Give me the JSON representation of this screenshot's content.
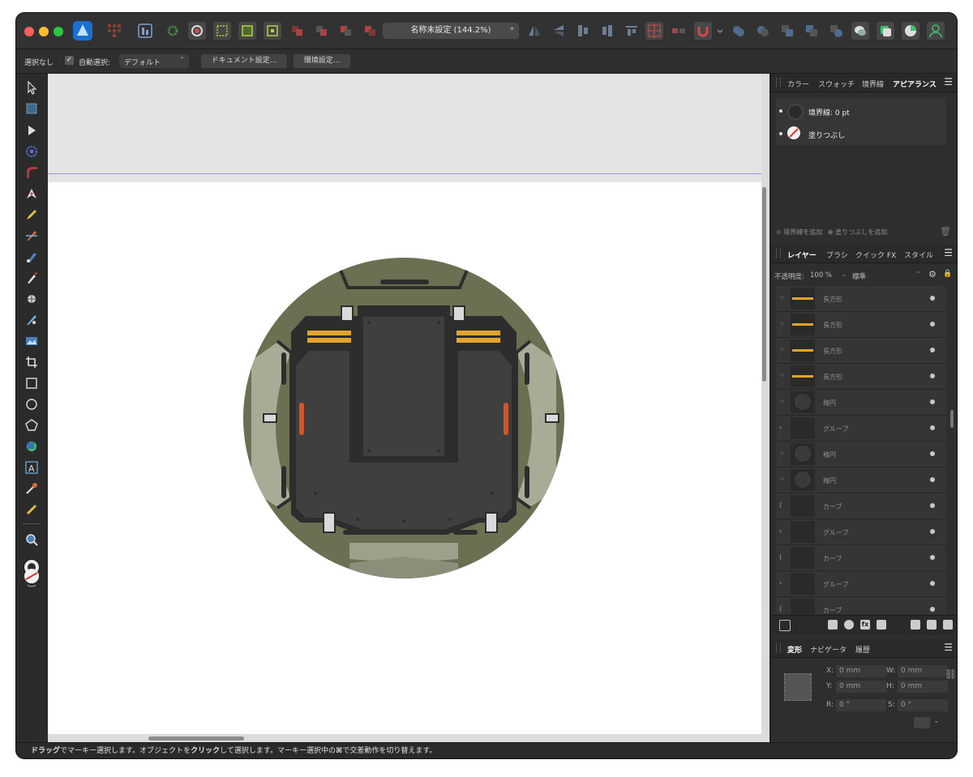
{
  "document_title": "名称未設定 (144.2%)",
  "modified_mark": "*",
  "context_toolbar": {
    "selection": "選択なし",
    "auto_select_label": "自動選択:",
    "auto_select_value": "デフォルト",
    "document_setup": "ドキュメント設定...",
    "preferences": "環境設定..."
  },
  "appearance_panel": {
    "tabs": [
      "カラー",
      "スウォッチ",
      "境界線",
      "アピアランス"
    ],
    "active_tab": "アピアランス",
    "stroke_label": "境界線: 0 pt",
    "fill_label": "塗りつぶし",
    "add_stroke": "境界線を追加",
    "add_fill": "塗りつぶしを追加"
  },
  "layers_panel": {
    "tabs": [
      "レイヤー",
      "ブラシ",
      "クイック FX",
      "スタイル"
    ],
    "active_tab": "レイヤー",
    "opacity_label": "不透明度:",
    "opacity_value": "100 %",
    "blend_mode": "標準",
    "layers": [
      {
        "name": "長方形",
        "icon": "shape"
      },
      {
        "name": "長方形",
        "icon": "shape"
      },
      {
        "name": "長方形",
        "icon": "shape"
      },
      {
        "name": "長方形",
        "icon": "shape"
      },
      {
        "name": "楕円",
        "icon": "shape"
      },
      {
        "name": "グループ",
        "icon": "expand"
      },
      {
        "name": "楕円",
        "icon": "shape"
      },
      {
        "name": "楕円",
        "icon": "shape"
      },
      {
        "name": "カーブ",
        "icon": "curve"
      },
      {
        "name": "グループ",
        "icon": "expand"
      },
      {
        "name": "カーブ",
        "icon": "curve"
      },
      {
        "name": "グループ",
        "icon": "expand"
      },
      {
        "name": "カーブ",
        "icon": "curve"
      }
    ]
  },
  "transform_panel": {
    "tabs": [
      "変形",
      "ナビゲータ",
      "履歴"
    ],
    "active_tab": "変形",
    "x_label": "X:",
    "x_value": "0 mm",
    "y_label": "Y:",
    "y_value": "0 mm",
    "w_label": "W:",
    "w_value": "0 mm",
    "h_label": "H:",
    "h_value": "0 mm",
    "r_label": "R:",
    "r_value": "0 °",
    "s_label": "S:",
    "s_value": "0 °"
  },
  "status_bar": {
    "drag": "ドラッグ",
    "part1": "でマーキー選択します。オブジェクトを",
    "click": "クリック",
    "part2": "して選択します。マーキー選択中の",
    "cmd": "⌘",
    "part3": "で交差動作を切り替えます。"
  },
  "colors": {
    "accent": "#1a6fd0",
    "artwork_olive": "#6b7053",
    "artwork_dark": "#3f3e3f",
    "artwork_yellow": "#e2a42b",
    "artwork_orange": "#d2562a"
  }
}
